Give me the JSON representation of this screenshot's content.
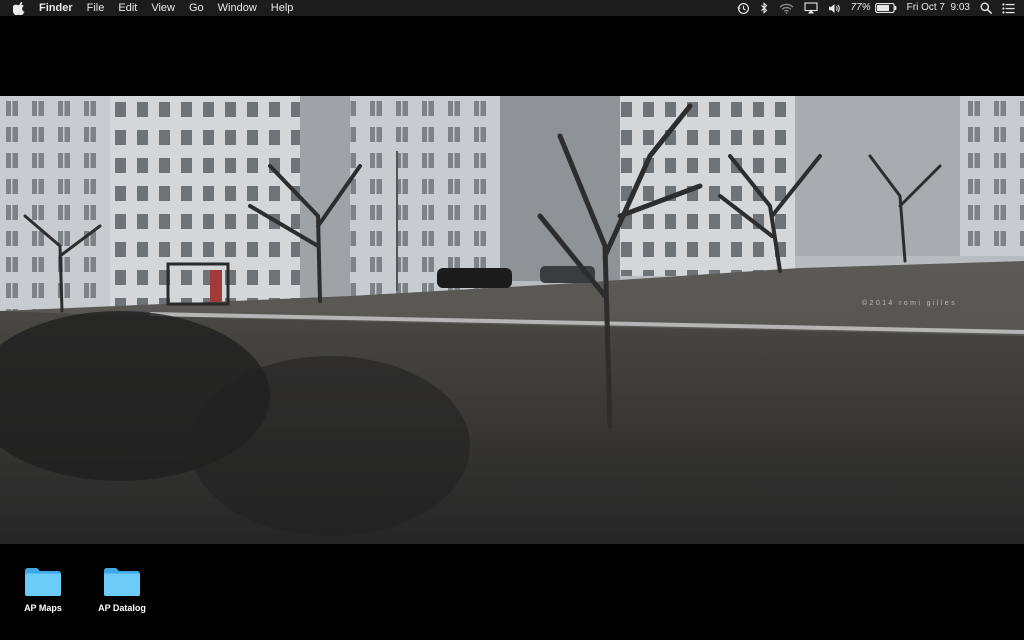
{
  "menubar": {
    "apple_icon": "apple-logo-icon",
    "app_name": "Finder",
    "menus": [
      "File",
      "Edit",
      "View",
      "Go",
      "Window",
      "Help"
    ],
    "status": {
      "icons": [
        "time-machine-icon",
        "bluetooth-icon",
        "wifi-icon",
        "airplay-icon",
        "volume-icon",
        "battery-icon",
        "spotlight-search-icon",
        "notification-center-icon"
      ],
      "battery_percent": "77%",
      "battery_level": 0.77,
      "clock": "Fri Oct 7  9:03"
    }
  },
  "wallpaper": {
    "watermark": "©2014 romi gilles"
  },
  "desktop": {
    "items": [
      {
        "label": "AP Maps",
        "icon": "folder-icon"
      },
      {
        "label": "AP Datalog",
        "icon": "folder-icon"
      }
    ]
  },
  "colors": {
    "menubar_bg": "#1c1c1c",
    "desktop_bg": "#000000",
    "folder_blue": "#5cc3f5"
  }
}
